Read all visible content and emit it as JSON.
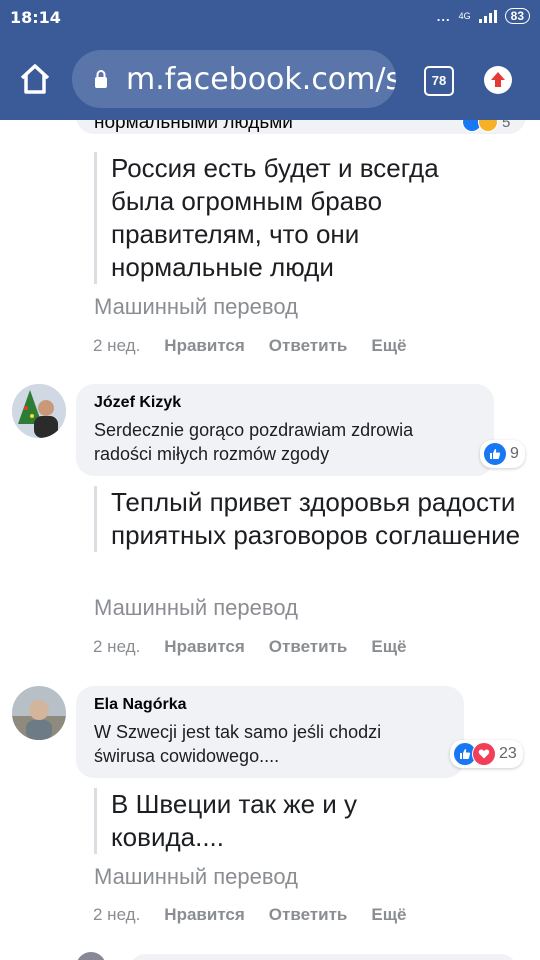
{
  "status_bar": {
    "time": "18:14",
    "dots": "...",
    "network": "4G",
    "battery": "83"
  },
  "browser": {
    "url": "m.facebook.com/s",
    "tab_count": "78",
    "toolbar_color": "#3b5b98"
  },
  "comments": [
    {
      "cut_text": "нормальными людьми",
      "reaction_count": "5",
      "translation": "Россия есть будет и всегда была огромным браво правителям, что они нормальные люди",
      "machine_translation": "Машинный перевод",
      "time": "2 нед.",
      "like": "Нравится",
      "reply": "Ответить",
      "more": "Ещё"
    },
    {
      "author": "Józef Kizyk",
      "text": "Serdecznie gorąco pozdrawiam zdrowia radości miłych rozmów zgody",
      "reaction_count": "9",
      "translation": "Теплый привет здоровья радости приятных разговоров соглашение",
      "machine_translation": "Машинный перевод",
      "time": "2 нед.",
      "like": "Нравится",
      "reply": "Ответить",
      "more": "Ещё"
    },
    {
      "author": "Ela Nagórka",
      "text": "W Szwecji jest tak samo jeśli chodzi świrusa cowidowego....",
      "reaction_count": "23",
      "translation": "В Швеции так же и у ковида....",
      "machine_translation": "Машинный перевод",
      "time": "2 нед.",
      "like": "Нравится",
      "reply": "Ответить",
      "more": "Ещё"
    }
  ],
  "colors": {
    "like_blue": "#1877f2",
    "love_red": "#f33e58",
    "bubble_gray": "#f0f2f5",
    "meta_gray": "#8a8d91"
  }
}
